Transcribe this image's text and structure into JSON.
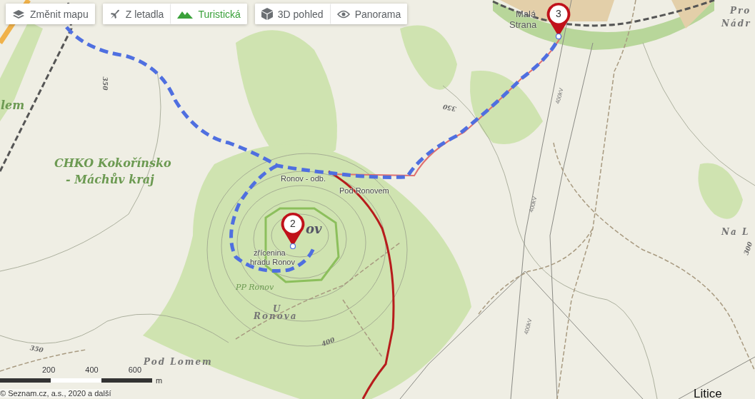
{
  "toolbar": [
    {
      "buttons": [
        {
          "label": "Změnit mapu"
        }
      ]
    },
    {
      "buttons": [
        {
          "label": "Z letadla",
          "selected": false
        },
        {
          "label": "Turistická",
          "selected": true
        }
      ]
    },
    {
      "buttons": [
        {
          "label": "3D pohled"
        },
        {
          "label": "Panorama"
        }
      ]
    }
  ],
  "labels": [
    {
      "text": "CHKO Kokořínsko",
      "kind": "area"
    },
    {
      "text": "- Máchův kraj",
      "kind": "area"
    },
    {
      "text": "lem",
      "kind": "area"
    },
    {
      "text": "Ronov - odb.",
      "kind": "place"
    },
    {
      "text": "Pod Ronovem",
      "kind": "place"
    },
    {
      "text": "ov",
      "kind": "peak"
    },
    {
      "text": "zřícenina",
      "kind": "place"
    },
    {
      "text": "hradu Ronov",
      "kind": "place"
    },
    {
      "text": "PP Ronov",
      "kind": "reserve"
    },
    {
      "text": "U",
      "kind": "terrain"
    },
    {
      "text": "Ronova",
      "kind": "terrain"
    },
    {
      "text": "Pod Lomem",
      "kind": "terrain"
    },
    {
      "text": "350",
      "kind": "contour"
    },
    {
      "text": "350",
      "kind": "contour"
    },
    {
      "text": "350",
      "kind": "contour"
    },
    {
      "text": "400",
      "kind": "contour"
    },
    {
      "text": "400kV",
      "kind": "powerline"
    },
    {
      "text": "400kV",
      "kind": "powerline"
    },
    {
      "text": "400kV",
      "kind": "powerline"
    },
    {
      "text": "Malá",
      "kind": "village"
    },
    {
      "text": "Strana",
      "kind": "village"
    },
    {
      "text": "Pro",
      "kind": "terrain"
    },
    {
      "text": "Nádr",
      "kind": "terrain"
    },
    {
      "text": "Na L",
      "kind": "terrain"
    },
    {
      "text": "300",
      "kind": "contour"
    },
    {
      "text": "Litice",
      "kind": "town"
    }
  ],
  "markers": [
    {
      "number": "2"
    },
    {
      "number": "3"
    }
  ],
  "scale": {
    "ticks": [
      "200",
      "400",
      "600"
    ],
    "unit": "m"
  },
  "copyright": "© Seznam.cz, a.s., 2020 a další"
}
